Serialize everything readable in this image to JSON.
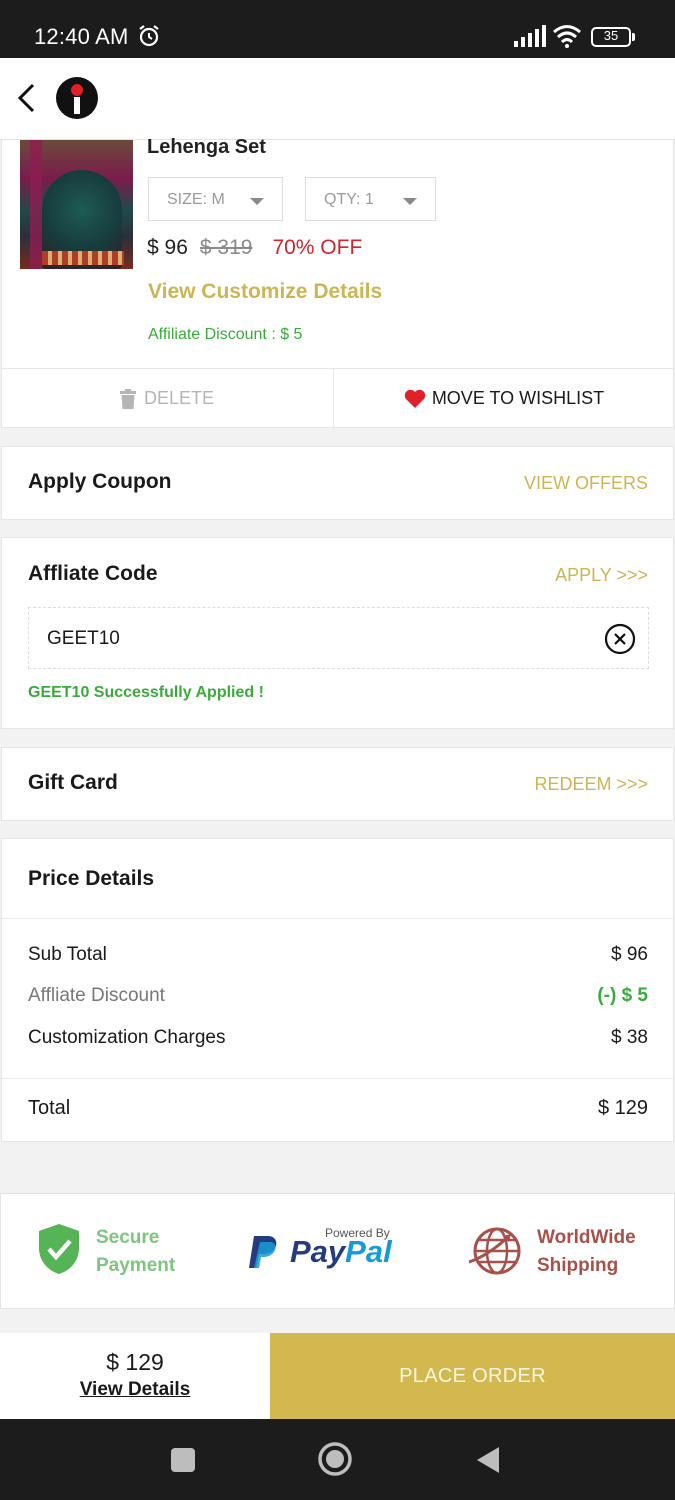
{
  "status_bar": {
    "time": "12:40 AM",
    "battery": "35",
    "icons": [
      "alarm-icon",
      "signal-icon",
      "wifi-icon",
      "battery-icon"
    ]
  },
  "header": {
    "icons": [
      "back-icon",
      "brand-logo-icon"
    ]
  },
  "product": {
    "name": "Lehenga Set",
    "size_label": "SIZE: M",
    "qty_label": "QTY: 1",
    "price_current": "$ 96",
    "price_original": "$ 319",
    "discount": "70% OFF",
    "customize_link": "View Customize Details",
    "affiliate_discount": "Affiliate Discount : $ 5",
    "delete_label": "DELETE",
    "wishlist_label": "MOVE TO WISHLIST"
  },
  "coupon": {
    "title": "Apply Coupon",
    "link": "VIEW OFFERS"
  },
  "affiliate": {
    "title": "Affliate Code",
    "link": "APPLY >>>",
    "code": "GEET10",
    "success": "GEET10 Successfully Applied !"
  },
  "gift_card": {
    "title": "Gift Card",
    "link": "REDEEM >>>"
  },
  "price_details": {
    "title": "Price Details",
    "sub_total_label": "Sub Total",
    "sub_total_value": "$ 96",
    "affiliate_label": "Affliate Discount",
    "affiliate_value": "(-) $ 5",
    "customization_label": "Customization Charges",
    "customization_value": "$ 38",
    "total_label": "Total",
    "total_value": "$ 129"
  },
  "trust": {
    "secure_line1": "Secure",
    "secure_line2": "Payment",
    "paypal_powered": "Powered By",
    "paypal_pay": "Pay",
    "paypal_pal": "Pal",
    "worldwide_line1": "WorldWide",
    "worldwide_line2": "Shipping"
  },
  "bottom_bar": {
    "total": "$ 129",
    "view_details": "View Details",
    "place_order": "PLACE ORDER"
  },
  "colors": {
    "accent_gold": "#cdb553",
    "place_order_bg": "#d3b84f",
    "discount_red": "#d0242f",
    "success_green": "#3aab3a"
  }
}
